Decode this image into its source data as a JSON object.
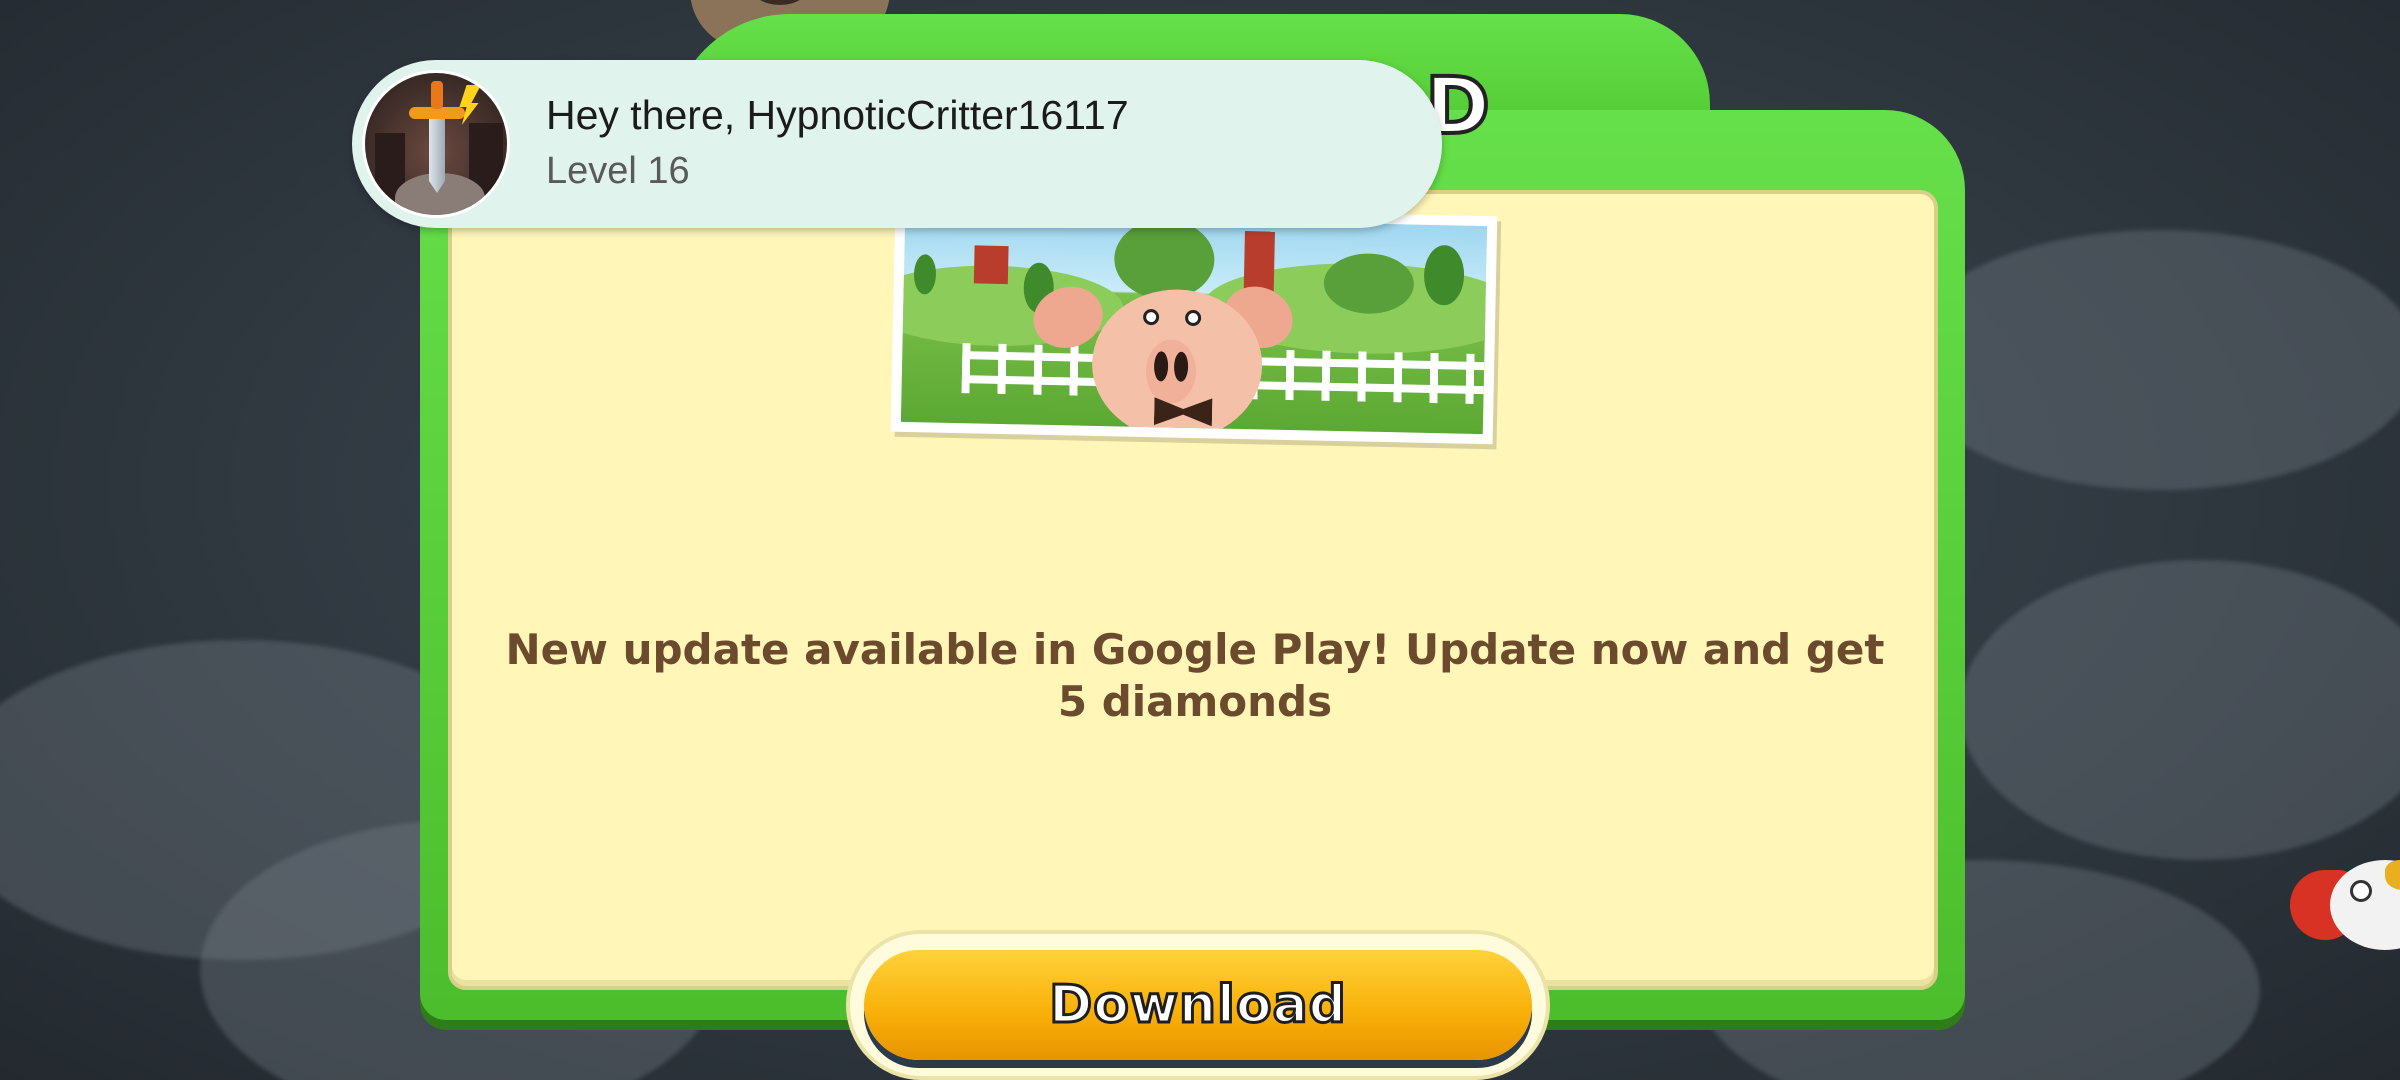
{
  "app": {
    "dialog_title": "D"
  },
  "toast": {
    "greeting": "Hey there, HypnoticCritter16117",
    "level": "Level 16",
    "avatar_icon": "sword-castle-avatar"
  },
  "dialog": {
    "message": "New update available in Google Play! Update now and get 5 diamonds",
    "download_label": "Download",
    "illustration": "farm-pig-picture"
  },
  "colors": {
    "dialog_green": "#55cc35",
    "panel_cream": "#fff6b8",
    "message_brown": "#6b4a2e",
    "button_orange": "#f9b10a",
    "toast_bg": "#e0f3ec"
  }
}
